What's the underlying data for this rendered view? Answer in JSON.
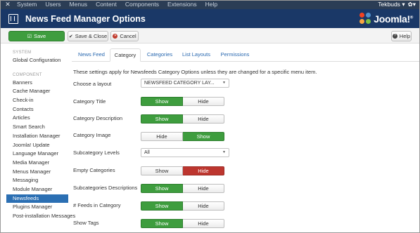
{
  "topbar": {
    "menu": [
      "System",
      "Users",
      "Menus",
      "Content",
      "Components",
      "Extensions",
      "Help"
    ],
    "user": "Tekbuds",
    "gear_caret": "▾"
  },
  "titlebar": {
    "title": "News Feed Manager Options",
    "logo_text": "Joomla!",
    "logo_sup": "®"
  },
  "toolbar": {
    "save_label": "Save",
    "save_close_label": "Save & Close",
    "cancel_label": "Cancel",
    "help_label": "Help"
  },
  "sidebar": {
    "system_heading": "SYSTEM",
    "system_items": [
      "Global Configuration"
    ],
    "component_heading": "COMPONENT",
    "component_items": [
      "Banners",
      "Cache Manager",
      "Check-in",
      "Contacts",
      "Articles",
      "Smart Search",
      "Installation Manager",
      "Joomla! Update",
      "Language Manager",
      "Media Manager",
      "Menus Manager",
      "Messaging",
      "Module Manager",
      "Newsfeeds",
      "Plugins Manager",
      "Post-installation Messages"
    ],
    "active_item": "Newsfeeds"
  },
  "tabs": [
    "News Feed",
    "Category",
    "Categories",
    "List Layouts",
    "Permissions"
  ],
  "active_tab": "Category",
  "description": "These settings apply for Newsfeeds Category Options unless they are changed for a specific menu item.",
  "form": {
    "layout": {
      "label": "Choose a layout",
      "value": "NEWSFEED CATEGORY LAY..."
    },
    "category_title": {
      "label": "Category Title",
      "left": "Show",
      "right": "Hide",
      "selected": "Show"
    },
    "category_description": {
      "label": "Category Description",
      "left": "Show",
      "right": "Hide",
      "selected": "Show"
    },
    "category_image": {
      "label": "Category Image",
      "left": "Hide",
      "right": "Show",
      "selected": "Show"
    },
    "subcategory_levels": {
      "label": "Subcategory Levels",
      "value": "All"
    },
    "empty_categories": {
      "label": "Empty Categories",
      "left": "Show",
      "right": "Hide",
      "selected": "Hide"
    },
    "subcategories_descriptions": {
      "label": "Subcategories Descriptions",
      "left": "Show",
      "right": "Hide",
      "selected": "Show"
    },
    "feeds_in_category": {
      "label": "# Feeds in Category",
      "left": "Show",
      "right": "Hide",
      "selected": "Show"
    },
    "show_tags": {
      "label": "Show Tags",
      "left": "Show",
      "right": "Hide",
      "selected": "Show"
    }
  },
  "colors": {
    "topbar": "#2b3d55",
    "titlebar": "#1a3867",
    "save_green": "#3e9d3e",
    "toggle_red": "#bd362f",
    "sidebar_active": "#2b6fb3",
    "link_blue": "#2a69b0"
  }
}
